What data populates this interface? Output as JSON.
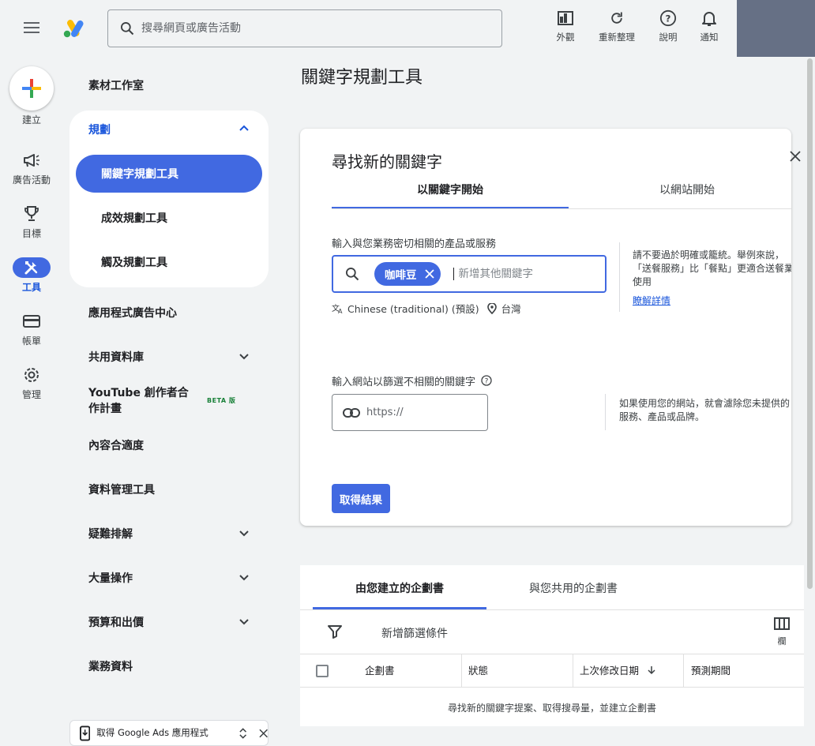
{
  "search": {
    "placeholder": "搜尋網頁或廣告活動"
  },
  "top_actions": [
    {
      "label": "外觀",
      "icon": "appearance-icon"
    },
    {
      "label": "重新整理",
      "icon": "refresh-icon"
    },
    {
      "label": "說明",
      "icon": "help-icon"
    },
    {
      "label": "通知",
      "icon": "notifications-icon"
    }
  ],
  "rail": {
    "create_label": "建立",
    "items": [
      {
        "label": "廣告活動",
        "icon": "megaphone-icon"
      },
      {
        "label": "目標",
        "icon": "trophy-icon"
      },
      {
        "label": "工具",
        "icon": "tools-icon",
        "active": true
      },
      {
        "label": "帳單",
        "icon": "credit-card-icon"
      },
      {
        "label": "管理",
        "icon": "gear-icon"
      }
    ]
  },
  "subnav": {
    "asset_studio": "素材工作室",
    "planning": {
      "label": "規劃",
      "items": [
        "關鍵字規劃工具",
        "成效規劃工具",
        "觸及規劃工具"
      ]
    },
    "app_ads_hub": "應用程式廣告中心",
    "shared_library": "共用資料庫",
    "youtube_creator": "YouTube 創作者合作計畫",
    "beta_badge": "BETA 版",
    "content_suitability": "內容合適度",
    "data_manager": "資料管理工具",
    "troubleshooting": "疑難排解",
    "bulk_actions": "大量操作",
    "budgets_bidding": "預算和出價",
    "business_data": "業務資料",
    "get_app": "取得 Google Ads 應用程式"
  },
  "main": {
    "page_title": "關鍵字規劃工具",
    "card": {
      "title": "尋找新的關鍵字",
      "tabs": [
        "以關鍵字開始",
        "以網站開始"
      ],
      "products_label": "輸入與您業務密切相關的產品或服務",
      "keyword_chip": "咖啡豆",
      "keyword_placeholder": "新增其他關鍵字",
      "language": "Chinese (traditional) (預設)",
      "location": "台灣",
      "help_keywords": "請不要過於明確或籠統。舉例來說，「送餐服務」比「餐點」更適合送餐業使用",
      "learn_more": "瞭解詳情",
      "website_label": "輸入網站以篩選不相關的關鍵字",
      "website_placeholder": "https://",
      "help_website": "如果使用您的網站，就會濾除您未提供的服務、產品或品牌。",
      "get_results": "取得結果"
    },
    "plans": {
      "tabs": [
        "由您建立的企劃書",
        "與您共用的企劃書"
      ],
      "add_filter": "新增篩選條件",
      "columns_label": "欄",
      "headers": [
        "企劃書",
        "狀態",
        "上次修改日期",
        "預測期間"
      ],
      "empty_message": "尋找新的關鍵字提案、取得搜尋量，並建立企劃書"
    }
  }
}
